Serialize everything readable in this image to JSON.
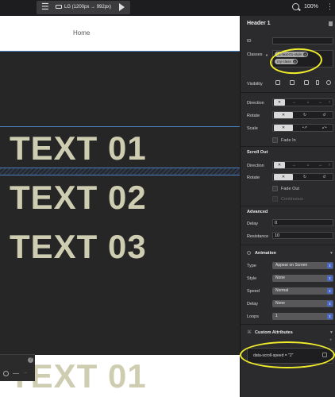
{
  "toolbar": {
    "device_label": "LG (1200px → 992px)",
    "zoom_label": "100%"
  },
  "canvas": {
    "nav_label": "Home",
    "texts": [
      "TEXT 01",
      "TEXT 02",
      "TEXT 03",
      "TEXT 01"
    ]
  },
  "panel": {
    "title": "Header 1",
    "id_label": "ID",
    "id_value": "",
    "classes_label": "Classes",
    "classes": [
      "h1-text-01-style",
      "my-class"
    ],
    "visibility_label": "Visibility",
    "scroll_in": {
      "direction_label": "Direction",
      "rotate_label": "Rotate",
      "scale_label": "Scale",
      "fade_label": "Fade In"
    },
    "scroll_out": {
      "section_label": "Scroll Out",
      "direction_label": "Direction",
      "rotate_label": "Rotate",
      "fade_label": "Fade Out",
      "continuous_label": "Continuous"
    },
    "advanced": {
      "section_label": "Advanced",
      "delay_label": "Delay",
      "delay_value": "0",
      "resistance_label": "Resistance",
      "resistance_value": "10"
    },
    "animation": {
      "section_label": "Animation",
      "type_label": "Type",
      "type_value": "Appear on Screen",
      "style_label": "Style",
      "style_value": "None",
      "speed_label": "Speed",
      "speed_value": "Normal",
      "delay_label": "Delay",
      "delay_value": "None",
      "loops_label": "Loops",
      "loops_value": "1"
    },
    "custom_attributes": {
      "section_label": "Custom Attributes",
      "entry": "data-scroll-speed = \"2\""
    }
  },
  "annotation_color": "#f0ed2b",
  "accent_color": "#4769c6"
}
